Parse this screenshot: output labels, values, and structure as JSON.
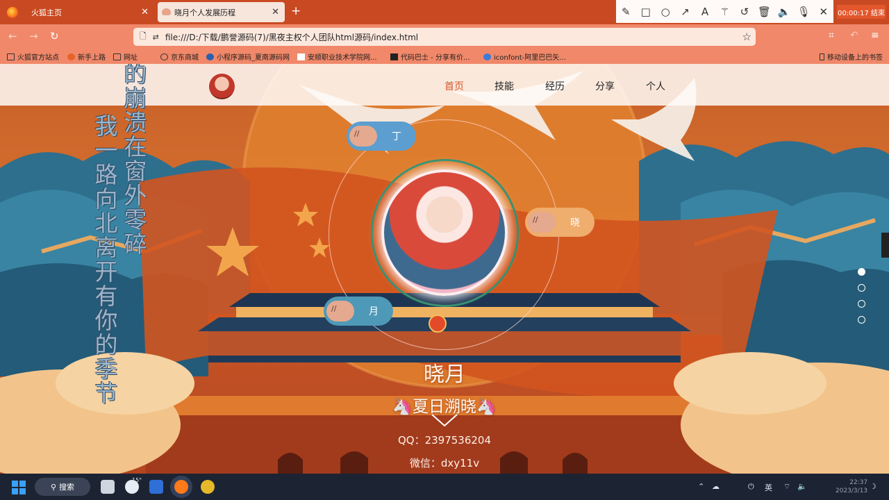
{
  "browser": {
    "tabs": [
      {
        "label": "火狐主页"
      },
      {
        "label": "晓月个人发展历程"
      }
    ],
    "url": "file:///D:/下载/鹏誉源码(7)/黑夜主权个人团队html源码/index.html",
    "record_time": "00:00:17 结束",
    "bookmarks": [
      "火狐官方站点",
      "新手上路",
      "网址",
      "京东商城",
      "小程序源码_夏南源码网",
      "安顺职业技术学院网...",
      "代码巴士 - 分享有价...",
      "iconfont-阿里巴巴矢...",
      "移动设备上的书签"
    ]
  },
  "site": {
    "nav": [
      "首页",
      "技能",
      "经历",
      "分享",
      "个人"
    ],
    "poem_right": "你的崩溃在窗外零碎",
    "poem_left": "我一路向北离开有你的季节",
    "pills": [
      "丁",
      "晓",
      "月"
    ],
    "name": "晓月",
    "subtitle": "🦄夏日溯晓🦄",
    "qq": "QQ：2397536204",
    "wechat": "微信：dxy11v"
  },
  "taskbar": {
    "search": "搜索",
    "weather": "15°",
    "lang": "英",
    "time": "22:37",
    "date": "2023/3/13"
  },
  "colors": {
    "tab_bar": "#c94a22",
    "nav_bar": "#f08869",
    "accent": "#d5562c",
    "pill_blue": "#5c9ecf",
    "pill_orange": "#efad6e",
    "pill_teal": "#4e99b8"
  }
}
